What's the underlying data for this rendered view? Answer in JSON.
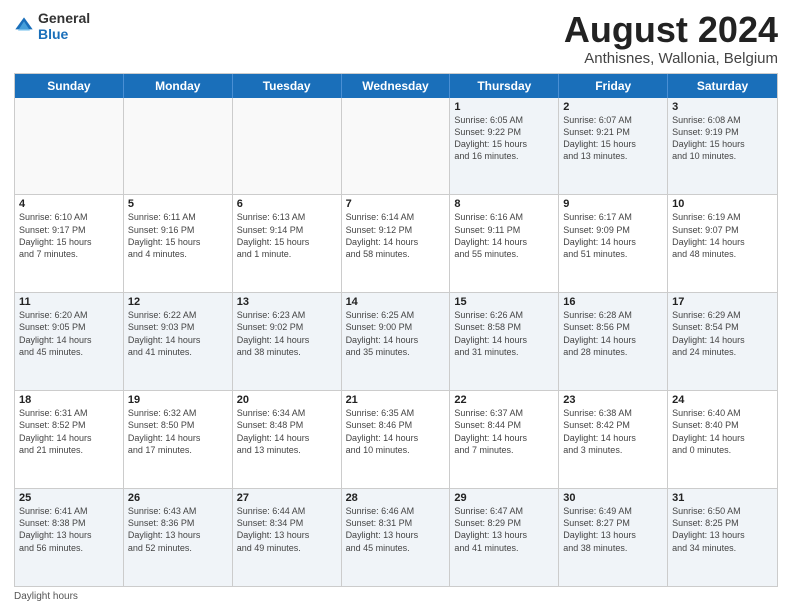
{
  "logo": {
    "general": "General",
    "blue": "Blue"
  },
  "title": "August 2024",
  "subtitle": "Anthisnes, Wallonia, Belgium",
  "days_of_week": [
    "Sunday",
    "Monday",
    "Tuesday",
    "Wednesday",
    "Thursday",
    "Friday",
    "Saturday"
  ],
  "footer_text": "Daylight hours",
  "weeks": [
    [
      {
        "day": "",
        "info": ""
      },
      {
        "day": "",
        "info": ""
      },
      {
        "day": "",
        "info": ""
      },
      {
        "day": "",
        "info": ""
      },
      {
        "day": "1",
        "info": "Sunrise: 6:05 AM\nSunset: 9:22 PM\nDaylight: 15 hours\nand 16 minutes."
      },
      {
        "day": "2",
        "info": "Sunrise: 6:07 AM\nSunset: 9:21 PM\nDaylight: 15 hours\nand 13 minutes."
      },
      {
        "day": "3",
        "info": "Sunrise: 6:08 AM\nSunset: 9:19 PM\nDaylight: 15 hours\nand 10 minutes."
      }
    ],
    [
      {
        "day": "4",
        "info": "Sunrise: 6:10 AM\nSunset: 9:17 PM\nDaylight: 15 hours\nand 7 minutes."
      },
      {
        "day": "5",
        "info": "Sunrise: 6:11 AM\nSunset: 9:16 PM\nDaylight: 15 hours\nand 4 minutes."
      },
      {
        "day": "6",
        "info": "Sunrise: 6:13 AM\nSunset: 9:14 PM\nDaylight: 15 hours\nand 1 minute."
      },
      {
        "day": "7",
        "info": "Sunrise: 6:14 AM\nSunset: 9:12 PM\nDaylight: 14 hours\nand 58 minutes."
      },
      {
        "day": "8",
        "info": "Sunrise: 6:16 AM\nSunset: 9:11 PM\nDaylight: 14 hours\nand 55 minutes."
      },
      {
        "day": "9",
        "info": "Sunrise: 6:17 AM\nSunset: 9:09 PM\nDaylight: 14 hours\nand 51 minutes."
      },
      {
        "day": "10",
        "info": "Sunrise: 6:19 AM\nSunset: 9:07 PM\nDaylight: 14 hours\nand 48 minutes."
      }
    ],
    [
      {
        "day": "11",
        "info": "Sunrise: 6:20 AM\nSunset: 9:05 PM\nDaylight: 14 hours\nand 45 minutes."
      },
      {
        "day": "12",
        "info": "Sunrise: 6:22 AM\nSunset: 9:03 PM\nDaylight: 14 hours\nand 41 minutes."
      },
      {
        "day": "13",
        "info": "Sunrise: 6:23 AM\nSunset: 9:02 PM\nDaylight: 14 hours\nand 38 minutes."
      },
      {
        "day": "14",
        "info": "Sunrise: 6:25 AM\nSunset: 9:00 PM\nDaylight: 14 hours\nand 35 minutes."
      },
      {
        "day": "15",
        "info": "Sunrise: 6:26 AM\nSunset: 8:58 PM\nDaylight: 14 hours\nand 31 minutes."
      },
      {
        "day": "16",
        "info": "Sunrise: 6:28 AM\nSunset: 8:56 PM\nDaylight: 14 hours\nand 28 minutes."
      },
      {
        "day": "17",
        "info": "Sunrise: 6:29 AM\nSunset: 8:54 PM\nDaylight: 14 hours\nand 24 minutes."
      }
    ],
    [
      {
        "day": "18",
        "info": "Sunrise: 6:31 AM\nSunset: 8:52 PM\nDaylight: 14 hours\nand 21 minutes."
      },
      {
        "day": "19",
        "info": "Sunrise: 6:32 AM\nSunset: 8:50 PM\nDaylight: 14 hours\nand 17 minutes."
      },
      {
        "day": "20",
        "info": "Sunrise: 6:34 AM\nSunset: 8:48 PM\nDaylight: 14 hours\nand 13 minutes."
      },
      {
        "day": "21",
        "info": "Sunrise: 6:35 AM\nSunset: 8:46 PM\nDaylight: 14 hours\nand 10 minutes."
      },
      {
        "day": "22",
        "info": "Sunrise: 6:37 AM\nSunset: 8:44 PM\nDaylight: 14 hours\nand 7 minutes."
      },
      {
        "day": "23",
        "info": "Sunrise: 6:38 AM\nSunset: 8:42 PM\nDaylight: 14 hours\nand 3 minutes."
      },
      {
        "day": "24",
        "info": "Sunrise: 6:40 AM\nSunset: 8:40 PM\nDaylight: 14 hours\nand 0 minutes."
      }
    ],
    [
      {
        "day": "25",
        "info": "Sunrise: 6:41 AM\nSunset: 8:38 PM\nDaylight: 13 hours\nand 56 minutes."
      },
      {
        "day": "26",
        "info": "Sunrise: 6:43 AM\nSunset: 8:36 PM\nDaylight: 13 hours\nand 52 minutes."
      },
      {
        "day": "27",
        "info": "Sunrise: 6:44 AM\nSunset: 8:34 PM\nDaylight: 13 hours\nand 49 minutes."
      },
      {
        "day": "28",
        "info": "Sunrise: 6:46 AM\nSunset: 8:31 PM\nDaylight: 13 hours\nand 45 minutes."
      },
      {
        "day": "29",
        "info": "Sunrise: 6:47 AM\nSunset: 8:29 PM\nDaylight: 13 hours\nand 41 minutes."
      },
      {
        "day": "30",
        "info": "Sunrise: 6:49 AM\nSunset: 8:27 PM\nDaylight: 13 hours\nand 38 minutes."
      },
      {
        "day": "31",
        "info": "Sunrise: 6:50 AM\nSunset: 8:25 PM\nDaylight: 13 hours\nand 34 minutes."
      }
    ]
  ]
}
